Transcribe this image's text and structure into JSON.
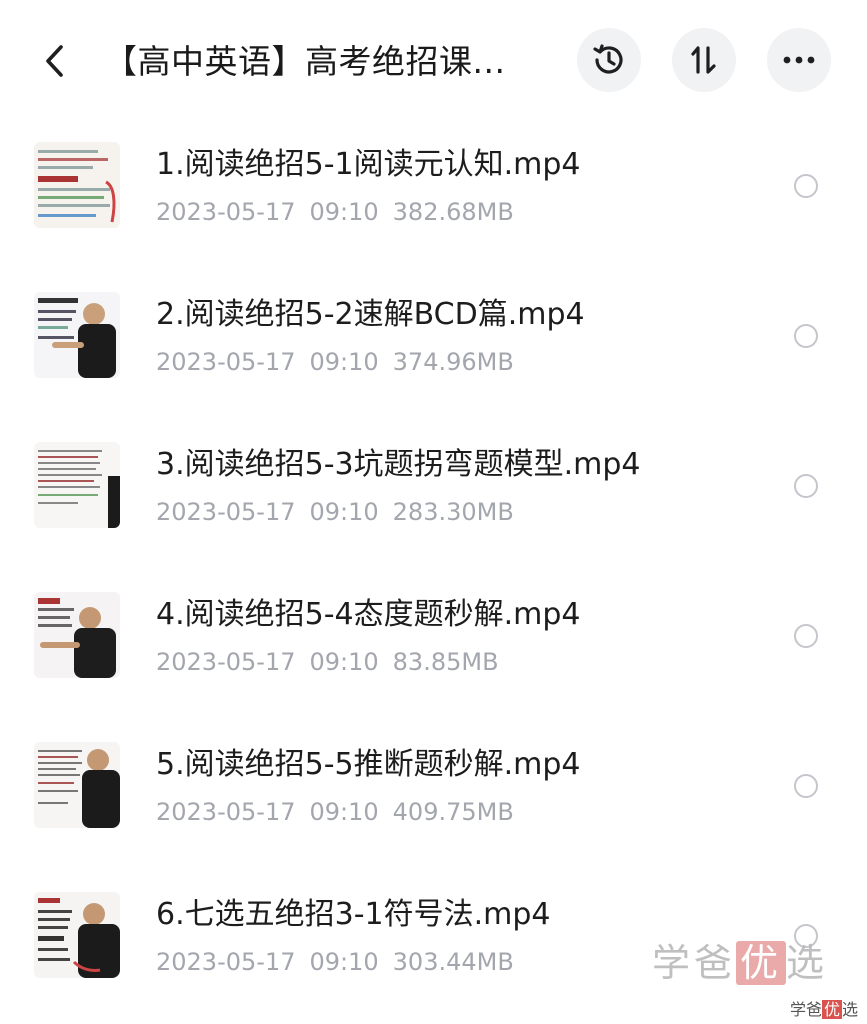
{
  "header": {
    "title": "【高中英语】高考绝招课...",
    "back_icon": "chevron-left-icon",
    "history_icon": "history-icon",
    "sort_icon": "sort-icon",
    "more_icon": "more-icon"
  },
  "files": [
    {
      "name": "1.阅读绝招5-1阅读元认知.mp4",
      "date": "2023-05-17",
      "time": "09:10",
      "size": "382.68MB"
    },
    {
      "name": "2.阅读绝招5-2速解BCD篇.mp4",
      "date": "2023-05-17",
      "time": "09:10",
      "size": "374.96MB"
    },
    {
      "name": "3.阅读绝招5-3坑题拐弯题模型.mp4",
      "date": "2023-05-17",
      "time": "09:10",
      "size": "283.30MB"
    },
    {
      "name": "4.阅读绝招5-4态度题秒解.mp4",
      "date": "2023-05-17",
      "time": "09:10",
      "size": "83.85MB"
    },
    {
      "name": "5.阅读绝招5-5推断题秒解.mp4",
      "date": "2023-05-17",
      "time": "09:10",
      "size": "409.75MB"
    },
    {
      "name": "6.七选五绝招3-1符号法.mp4",
      "date": "2023-05-17",
      "time": "09:10",
      "size": "303.44MB"
    }
  ],
  "watermark": {
    "text_a": "学爸",
    "text_hl": "优",
    "text_b": "选",
    "small_a": "学爸",
    "small_hl": "优",
    "small_b": "选"
  }
}
